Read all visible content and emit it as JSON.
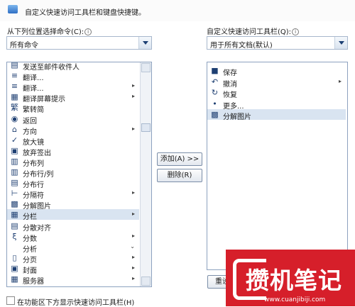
{
  "header": {
    "text": "自定义快速访问工具栏和键盘快捷键。"
  },
  "left": {
    "label": "从下列位置选择命令(C):",
    "combo_value": "所有命令",
    "items": [
      {
        "icon": "▤",
        "text": "发送至邮件收件人",
        "sub": ""
      },
      {
        "icon": "≡",
        "text": "翻译...",
        "sub": ""
      },
      {
        "icon": "≡",
        "text": "翻译...",
        "sub": "▸"
      },
      {
        "icon": "▦",
        "text": "翻译屏幕提示",
        "sub": "▸"
      },
      {
        "icon": "繁",
        "text": "繁转简",
        "sub": ""
      },
      {
        "icon": "◉",
        "text": "返回",
        "sub": ""
      },
      {
        "icon": "⌂",
        "text": "方向",
        "sub": "▸"
      },
      {
        "icon": "✓",
        "text": "放大镜",
        "sub": ""
      },
      {
        "icon": "▣",
        "text": "放弃签出",
        "sub": ""
      },
      {
        "icon": "▥",
        "text": "分布列",
        "sub": ""
      },
      {
        "icon": "▥",
        "text": "分布行/列",
        "sub": ""
      },
      {
        "icon": "▤",
        "text": "分布行",
        "sub": ""
      },
      {
        "icon": "⊢",
        "text": "分隔符",
        "sub": "▸"
      },
      {
        "icon": "▩",
        "text": "分解图片",
        "sub": ""
      },
      {
        "icon": "▦",
        "text": "分栏",
        "sub": "▸"
      },
      {
        "icon": "▤",
        "text": "分散对齐",
        "sub": ""
      },
      {
        "icon": "ξ",
        "text": "分数",
        "sub": "▸"
      },
      {
        "icon": "",
        "text": "分析",
        "sub": "⌄"
      },
      {
        "icon": "▯",
        "text": "分页",
        "sub": "▸"
      },
      {
        "icon": "▣",
        "text": "封面",
        "sub": "▸"
      },
      {
        "icon": "▦",
        "text": "服务器",
        "sub": "▸"
      }
    ]
  },
  "right": {
    "label": "自定义快速访问工具栏(Q):",
    "combo_value": "用于所有文档(默认)",
    "items": [
      {
        "icon": "■",
        "text": "保存"
      },
      {
        "icon": "↶",
        "text": "撤消",
        "sub": "▸"
      },
      {
        "icon": "↻",
        "text": "恢复"
      },
      {
        "icon": "•",
        "text": "更多..."
      },
      {
        "icon": "▩",
        "text": "分解图片"
      }
    ],
    "reset_label": "重设"
  },
  "buttons": {
    "add": "添加(A) >>",
    "remove": "删除(R)"
  },
  "footer": {
    "checkbox_label": "在功能区下方显示快速访问工具栏(H)"
  },
  "watermark": {
    "text": "攒机笔记",
    "url": "www.cuanjibiji.com"
  }
}
